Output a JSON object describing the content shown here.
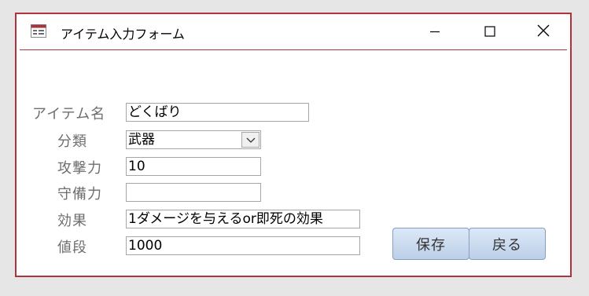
{
  "window": {
    "title": "アイテム入力フォーム",
    "border_color": "#b0323c"
  },
  "form": {
    "fields": [
      {
        "label": "アイテム名",
        "value": ""
      },
      {
        "label": "分類",
        "value": "武器"
      },
      {
        "label": "攻撃力",
        "value": "10"
      },
      {
        "label": "守備力",
        "value": ""
      },
      {
        "label": "効果",
        "value": "1ダメージを与えるor即死の効果"
      },
      {
        "label": "値段",
        "value": "1000"
      }
    ],
    "name_value": "どくばり"
  },
  "buttons": {
    "save_label": "保存",
    "back_label": "戻る"
  },
  "icons": {
    "app": "form-icon",
    "minimize": "minimize-icon",
    "maximize": "maximize-icon",
    "close": "close-icon",
    "dropdown": "chevron-down-icon"
  }
}
